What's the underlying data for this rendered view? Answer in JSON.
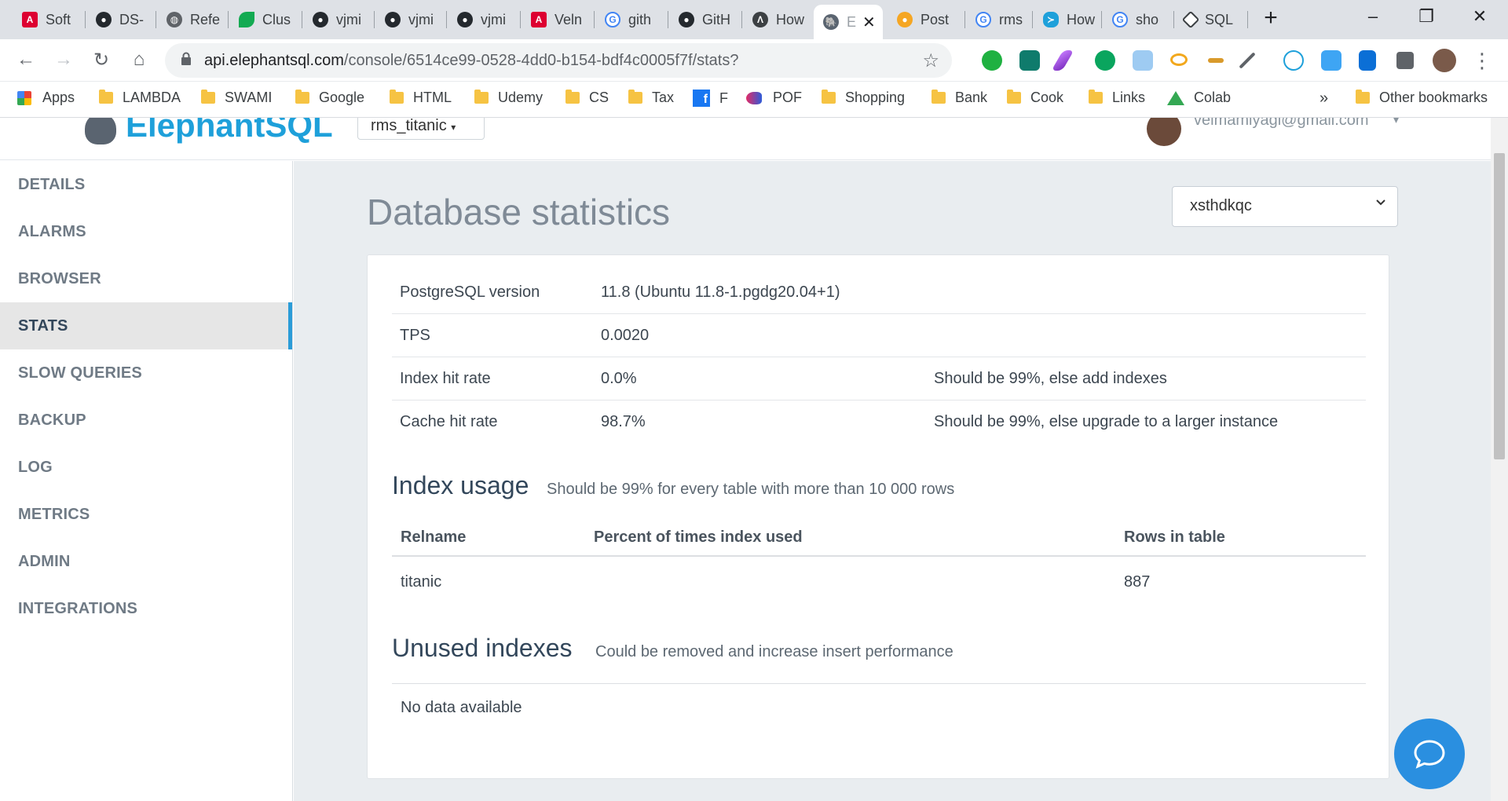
{
  "browser": {
    "tabs": [
      {
        "label": "Soft",
        "icon": "angular-icon",
        "color": "#dd0031"
      },
      {
        "label": "DS-",
        "icon": "github-icon",
        "color": "#24292e"
      },
      {
        "label": "Refe",
        "icon": "globe-icon",
        "color": "#5f6368"
      },
      {
        "label": "Clus",
        "icon": "mongodb-leaf-icon",
        "color": "#13aa52"
      },
      {
        "label": "vjmi",
        "icon": "github-icon",
        "color": "#24292e"
      },
      {
        "label": "vjmi",
        "icon": "github-icon",
        "color": "#24292e"
      },
      {
        "label": "vjmi",
        "icon": "github-icon",
        "color": "#24292e"
      },
      {
        "label": "Veln",
        "icon": "angular-icon",
        "color": "#dd0031"
      },
      {
        "label": "gith",
        "icon": "google-icon",
        "color": "#4285f4"
      },
      {
        "label": "GitH",
        "icon": "github-icon",
        "color": "#24292e"
      },
      {
        "label": "How",
        "icon": "arrow-a-icon",
        "color": "#3c4043"
      },
      {
        "label": "E",
        "icon": "elephant-icon",
        "color": "#5a6470",
        "active": true
      },
      {
        "label": "Post",
        "icon": "postman-icon",
        "color": "#f5a623"
      },
      {
        "label": "rms",
        "icon": "google-icon",
        "color": "#4285f4"
      },
      {
        "label": "How",
        "icon": "fish-icon",
        "color": "#1ea0da"
      },
      {
        "label": "sho",
        "icon": "google-icon",
        "color": "#4285f4"
      },
      {
        "label": "SQL",
        "icon": "diamond-icon",
        "color": "#3c4043"
      }
    ],
    "new_tab": "+",
    "window_controls": {
      "minimize": "–",
      "restore": "❐",
      "close": "✕"
    },
    "address": {
      "host": "api.elephantsql.com",
      "path": "/console/6514ce99-0528-4dd0-b154-bdf4c0005f7f/stats?"
    },
    "bookmarks": [
      {
        "label": "Apps",
        "kind": "apps"
      },
      {
        "label": "LAMBDA",
        "kind": "folder"
      },
      {
        "label": "SWAMI",
        "kind": "folder"
      },
      {
        "label": "Google",
        "kind": "folder"
      },
      {
        "label": "HTML",
        "kind": "folder"
      },
      {
        "label": "Udemy",
        "kind": "folder"
      },
      {
        "label": "CS",
        "kind": "folder"
      },
      {
        "label": "Tax",
        "kind": "folder"
      },
      {
        "label": "F",
        "kind": "facebook"
      },
      {
        "label": "POF",
        "kind": "pof"
      },
      {
        "label": "Shopping",
        "kind": "folder"
      },
      {
        "label": "Bank",
        "kind": "folder"
      },
      {
        "label": "Cook",
        "kind": "folder"
      },
      {
        "label": "Links",
        "kind": "folder"
      },
      {
        "label": "Colab",
        "kind": "drive"
      }
    ],
    "bookmarks_overflow": "»",
    "other_bookmarks": "Other bookmarks"
  },
  "header": {
    "logo_text": "ElephantSQL",
    "instance_select": "rms_titanic",
    "user_email": "velmamiyagi@gmail.com"
  },
  "sidebar": {
    "items": [
      {
        "label": "DETAILS"
      },
      {
        "label": "ALARMS"
      },
      {
        "label": "BROWSER"
      },
      {
        "label": "STATS",
        "active": true
      },
      {
        "label": "SLOW QUERIES"
      },
      {
        "label": "BACKUP"
      },
      {
        "label": "LOG"
      },
      {
        "label": "METRICS"
      },
      {
        "label": "ADMIN"
      },
      {
        "label": "INTEGRATIONS"
      }
    ]
  },
  "main": {
    "title": "Database statistics",
    "db_select": "xsthdkqc",
    "stats": [
      {
        "label": "PostgreSQL version",
        "value": "11.8 (Ubuntu 11.8-1.pgdg20.04+1)",
        "note": ""
      },
      {
        "label": "TPS",
        "value": "0.0020",
        "note": ""
      },
      {
        "label": "Index hit rate",
        "value": "0.0%",
        "note": "Should be 99%, else add indexes"
      },
      {
        "label": "Cache hit rate",
        "value": "98.7%",
        "note": "Should be 99%, else upgrade to a larger instance"
      }
    ],
    "index_usage": {
      "title": "Index usage",
      "subtitle": "Should be 99% for every table with more than 10 000 rows",
      "columns": [
        "Relname",
        "Percent of times index used",
        "Rows in table"
      ],
      "rows": [
        [
          "titanic",
          "",
          "887"
        ]
      ]
    },
    "unused_indexes": {
      "title": "Unused indexes",
      "subtitle": "Could be removed and increase insert performance",
      "empty_text": "No data available"
    }
  },
  "colors": {
    "accent": "#2b9cd8",
    "brand": "#1ea0da",
    "chat": "#2a8fe0"
  }
}
